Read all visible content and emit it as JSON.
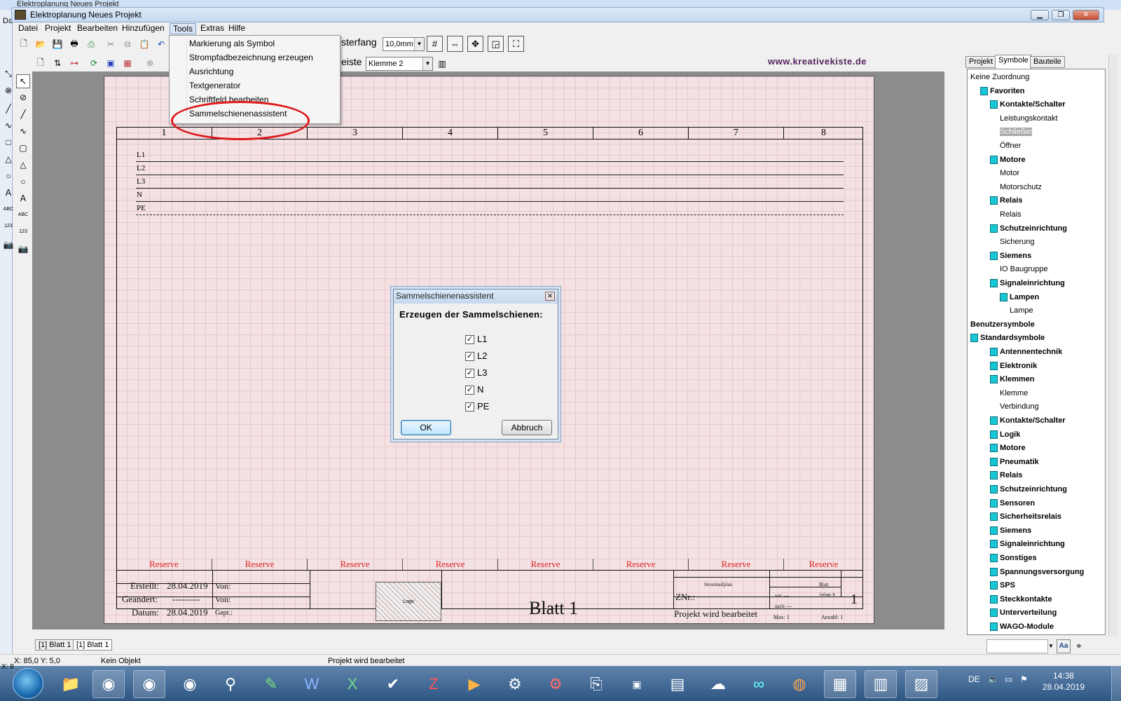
{
  "window": {
    "bg_title": "Elektroplanung Neues Projekt",
    "title": "Elektroplanung Neues Projekt",
    "outer_left_label": "Da"
  },
  "menu": [
    "Datei",
    "Projekt",
    "Bearbeiten",
    "Hinzufügen",
    "Tools",
    "Extras",
    "Hilfe"
  ],
  "tools_menu": {
    "items": [
      "Markierung als Symbol",
      "Strompfadbezeichnung erzeugen",
      "Ausrichtung",
      "Textgenerator",
      "Schriftfeld bearbeiten",
      "Sammelschienenassistent"
    ]
  },
  "toolbar": {
    "raster_label": "sterfang",
    "raster_value": "10,0mm",
    "leiste_label": "eiste",
    "leiste_value": "Klemme 2",
    "website": "www.kreativekiste.de"
  },
  "sheet": {
    "columns": [
      "1",
      "2",
      "3",
      "4",
      "5",
      "6",
      "7",
      "8"
    ],
    "rails": [
      "L1",
      "L2",
      "L3",
      "N",
      "PE"
    ],
    "reserve": [
      "Reserve",
      "Reserve",
      "Reserve",
      "Reserve",
      "Reserve",
      "Reserve",
      "Reserve",
      "Reserve"
    ],
    "title_block": {
      "erstellt_label": "Erstellt:",
      "erstellt_value": "28.04.2019",
      "geaendert_label": "Geändert:",
      "geaendert_value": "---------",
      "datum_label": "Datum:",
      "datum_value": "28.04.2019",
      "von1": "Von:",
      "von2": "Von:",
      "gepr": "Gepr.:",
      "logo": "Logo",
      "sheet_title": "Blatt 1",
      "stromlaufplan": "Stromlaufplan",
      "blatt_hdr": "Blatt",
      "znr": "ZNr.:",
      "projekt": "Projekt wird bearbeitet",
      "vor": "vor: ---",
      "nach": "nach: ---",
      "anlage": "Anlage X",
      "sheet_num": "1",
      "max": "Max: 1",
      "anzahl": "Anzahl: 1"
    }
  },
  "dialog": {
    "title": "Sammelschienenassistent",
    "heading": "Erzeugen der Sammelschienen:",
    "checkboxes": [
      {
        "label": "L1",
        "checked": "✓"
      },
      {
        "label": "L2",
        "checked": "✓"
      },
      {
        "label": "L3",
        "checked": "✓"
      },
      {
        "label": "N",
        "checked": "✓"
      },
      {
        "label": "PE",
        "checked": "✓"
      }
    ],
    "ok": "OK",
    "cancel": "Abbruch"
  },
  "right_panel": {
    "tabs": [
      "Projekt",
      "Symbole",
      "Bauteile"
    ],
    "tree": [
      {
        "t": "Keine Zuordnung",
        "lvl": 0,
        "b": false,
        "f": false
      },
      {
        "t": "Favoriten",
        "lvl": 1,
        "b": true,
        "f": true
      },
      {
        "t": "Kontakte/Schalter",
        "lvl": 2,
        "b": true,
        "f": true
      },
      {
        "t": "Leistungskontakt",
        "lvl": 3,
        "b": false,
        "f": false
      },
      {
        "t": "Schließer",
        "lvl": 3,
        "b": false,
        "f": false,
        "sel": true
      },
      {
        "t": "Öffner",
        "lvl": 3,
        "b": false,
        "f": false
      },
      {
        "t": "Motore",
        "lvl": 2,
        "b": true,
        "f": true
      },
      {
        "t": "Motor",
        "lvl": 3,
        "b": false,
        "f": false
      },
      {
        "t": "Motorschutz",
        "lvl": 3,
        "b": false,
        "f": false
      },
      {
        "t": "Relais",
        "lvl": 2,
        "b": true,
        "f": true
      },
      {
        "t": "Relais",
        "lvl": 3,
        "b": false,
        "f": false
      },
      {
        "t": "Schutzeinrichtung",
        "lvl": 2,
        "b": true,
        "f": true
      },
      {
        "t": "Sicherung",
        "lvl": 3,
        "b": false,
        "f": false
      },
      {
        "t": "Siemens",
        "lvl": 2,
        "b": true,
        "f": true
      },
      {
        "t": "IO Baugruppe",
        "lvl": 3,
        "b": false,
        "f": false
      },
      {
        "t": "Signaleinrichtung",
        "lvl": 2,
        "b": true,
        "f": true
      },
      {
        "t": "Lampen",
        "lvl": 3,
        "b": true,
        "f": true
      },
      {
        "t": "Lampe",
        "lvl": 4,
        "b": false,
        "f": false
      },
      {
        "t": "Benutzersymbole",
        "lvl": 0,
        "b": true,
        "f": false
      },
      {
        "t": "Standardsymbole",
        "lvl": 0,
        "b": true,
        "f": true
      },
      {
        "t": "Antennentechnik",
        "lvl": 2,
        "b": true,
        "f": true
      },
      {
        "t": "Elektronik",
        "lvl": 2,
        "b": true,
        "f": true
      },
      {
        "t": "Klemmen",
        "lvl": 2,
        "b": true,
        "f": true
      },
      {
        "t": "Klemme",
        "lvl": 3,
        "b": false,
        "f": false
      },
      {
        "t": "Verbindung",
        "lvl": 3,
        "b": false,
        "f": false
      },
      {
        "t": "Kontakte/Schalter",
        "lvl": 2,
        "b": true,
        "f": true
      },
      {
        "t": "Logik",
        "lvl": 2,
        "b": true,
        "f": true
      },
      {
        "t": "Motore",
        "lvl": 2,
        "b": true,
        "f": true
      },
      {
        "t": "Pneumatik",
        "lvl": 2,
        "b": true,
        "f": true
      },
      {
        "t": "Relais",
        "lvl": 2,
        "b": true,
        "f": true
      },
      {
        "t": "Schutzeinrichtung",
        "lvl": 2,
        "b": true,
        "f": true
      },
      {
        "t": "Sensoren",
        "lvl": 2,
        "b": true,
        "f": true
      },
      {
        "t": "Sicherheitsrelais",
        "lvl": 2,
        "b": true,
        "f": true
      },
      {
        "t": "Siemens",
        "lvl": 2,
        "b": true,
        "f": true
      },
      {
        "t": "Signaleinrichtung",
        "lvl": 2,
        "b": true,
        "f": true
      },
      {
        "t": "Sonstiges",
        "lvl": 2,
        "b": true,
        "f": true
      },
      {
        "t": "Spannungsversorgung",
        "lvl": 2,
        "b": true,
        "f": true
      },
      {
        "t": "SPS",
        "lvl": 2,
        "b": true,
        "f": true
      },
      {
        "t": "Steckkontakte",
        "lvl": 2,
        "b": true,
        "f": true
      },
      {
        "t": "Unterverteilung",
        "lvl": 2,
        "b": true,
        "f": true
      },
      {
        "t": "WAGO-Module",
        "lvl": 2,
        "b": true,
        "f": true
      }
    ]
  },
  "sheet_tabs": [
    "[1] Blatt 1",
    "[1] Blatt 1"
  ],
  "status": {
    "coords": "X: 85,0  Y:   5,0",
    "object": "Kein Objekt",
    "project": "Projekt wird bearbeitet",
    "lower_left": "X: 8"
  },
  "taskbar": {
    "lang": "DE",
    "time": "14:38",
    "date": "28.04.2019"
  }
}
